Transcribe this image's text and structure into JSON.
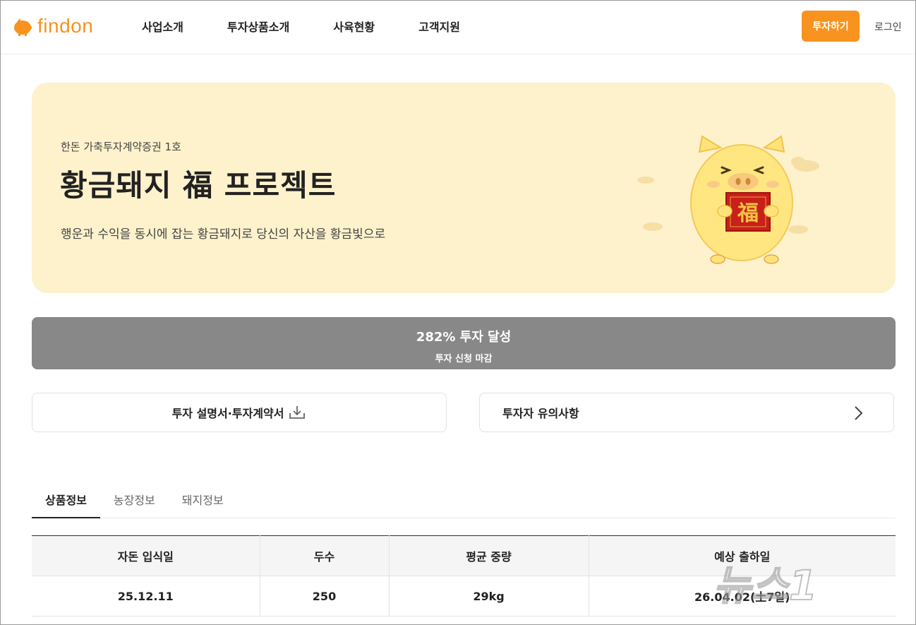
{
  "header": {
    "logo_text": "findon",
    "nav": [
      "사업소개",
      "투자상품소개",
      "사육현황",
      "고객지원"
    ],
    "invest_button": "투자하기",
    "login": "로그인"
  },
  "hero": {
    "subtitle": "한돈 가축투자계약증권 1호",
    "title": "황금돼지 福 프로젝트",
    "description": "행운과 수익을 동시에 잡는 황금돼지로 당신의 자산을 황금빛으로",
    "card_char": "福"
  },
  "status": {
    "main": "282% 투자 달성",
    "sub": "투자 신청 마감"
  },
  "documents": {
    "prospectus": "투자 설명서·투자계약서",
    "caution": "투자자 유의사항"
  },
  "tabs": [
    "상품정보",
    "농장정보",
    "돼지정보"
  ],
  "table": {
    "headers": [
      "자돈 입식일",
      "두수",
      "평균 중량",
      "예상 출하일"
    ],
    "rows": [
      [
        "25.12.11",
        "250",
        "29kg",
        "26.04.02(土7일)"
      ]
    ]
  },
  "watermark": "뉴스1",
  "colors": {
    "brand": "#f7931e",
    "hero_bg": "#fdf2cc",
    "status_bg": "#888888"
  }
}
